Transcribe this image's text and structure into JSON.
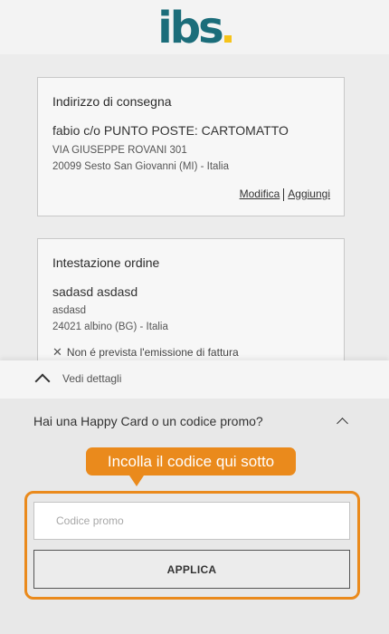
{
  "logo": {
    "text": "ibs",
    "brand_color": "#1b6d7a",
    "dot_color": "#f6c31a"
  },
  "delivery": {
    "title": "Indirizzo di consegna",
    "name": "fabio c/o PUNTO POSTE: CARTOMATTO",
    "address_line_1": "VIA GIUSEPPE ROVANI 301",
    "address_line_2": "20099 Sesto San Giovanni (MI) - Italia",
    "edit_link": "Modifica",
    "add_link": "Aggiungi"
  },
  "billing": {
    "title": "Intestazione ordine",
    "name": "sadasd asdasd",
    "address_line_1": "asdasd",
    "address_line_2": "24021 albino (BG) - Italia",
    "note_icon": "x-icon",
    "note": "Non é prevista l'emissione di fattura"
  },
  "details": {
    "label": "Vedi dettagli",
    "icon": "chevron-up-icon"
  },
  "promo": {
    "question": "Hai una Happy Card o un codice promo?",
    "tooltip": "Incolla il codice qui sotto",
    "input_placeholder": "Codice promo",
    "input_value": "",
    "apply_label": "APPLICA",
    "highlight_color": "#ea8a1c"
  }
}
